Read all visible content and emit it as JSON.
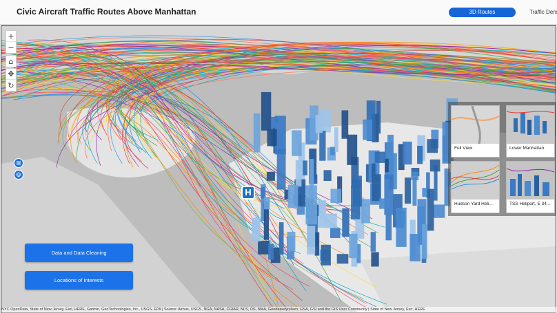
{
  "header": {
    "title": "Civic Aircraft Traffic Routes Above Manhattan",
    "tabs": [
      {
        "label": "3D Routes",
        "active": true
      },
      {
        "label": "Traffic Density",
        "active": false
      }
    ]
  },
  "map": {
    "tools": [
      {
        "name": "zoom-in",
        "glyph": "+"
      },
      {
        "name": "zoom-out",
        "glyph": "−"
      },
      {
        "name": "home",
        "glyph": "⌂"
      },
      {
        "name": "pan",
        "glyph": "✥"
      },
      {
        "name": "rotate",
        "glyph": "↻"
      }
    ],
    "side_buttons": [
      "list-icon",
      "layers-icon"
    ],
    "heliport_marker": "H",
    "buttons": {
      "data_cleaning": "Data and Data Cleaning",
      "locations": "Locations of Interests"
    },
    "slides": [
      {
        "title": "Full View"
      },
      {
        "title": "Lower Manhattan"
      },
      {
        "title": "Hudson Yard Heli..."
      },
      {
        "title": "TSS Heliport, E 34..."
      }
    ],
    "attribution": "NYC OpenData, State of New Jersey, Esri, HERE, Garmin, GeoTechnologies, Inc., USGS, EPA | Source: Airbus, USGS, NGA, NASA, CGIAR, NLS, OS, NMA, Geodatastyrelsen, GSA, GSI and the GIS User Community | State of New Jersey, Esri, HERE"
  },
  "colors": {
    "accent": "#1c72e8",
    "route_palette": [
      "#e53935",
      "#fb8c00",
      "#fdd835",
      "#43a047",
      "#1e88e5",
      "#8e24aa",
      "#ec407a",
      "#00acc1",
      "#7cb342",
      "#ff7043"
    ],
    "buildings": "#2f6db3"
  }
}
